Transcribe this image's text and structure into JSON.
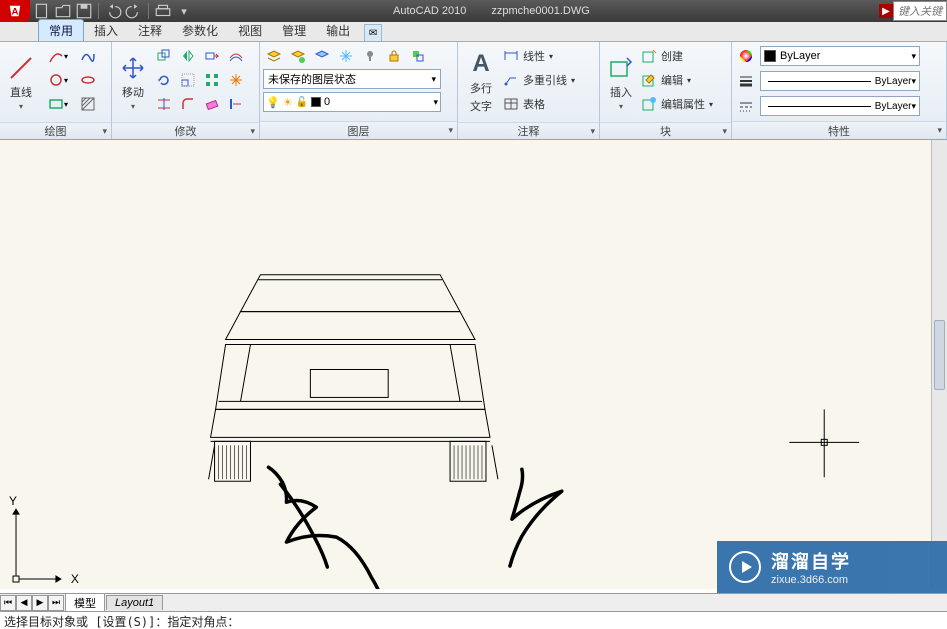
{
  "title": {
    "app": "AutoCAD 2010",
    "file": "zzpmche0001.DWG",
    "search_hint": "键入关键"
  },
  "tabs": [
    "常用",
    "插入",
    "注释",
    "参数化",
    "视图",
    "管理",
    "输出"
  ],
  "active_tab": 0,
  "panels": {
    "draw": "绘图",
    "modify": "修改",
    "layers": "图层",
    "annotation": "注释",
    "block": "块",
    "properties": "特性"
  },
  "buttons": {
    "line": "直线",
    "move": "移动",
    "mtext1": "多行",
    "mtext2": "文字",
    "insert": "插入"
  },
  "layer": {
    "state_label": "未保存的图层状态",
    "current_layer": "0"
  },
  "annotation": {
    "linear": "线性",
    "multileader": "多重引线",
    "table": "表格"
  },
  "block": {
    "create": "创建",
    "edit": "编辑",
    "edit_attrib": "编辑属性"
  },
  "properties": {
    "color": "ByLayer",
    "lineweight": "ByLayer",
    "linetype": "ByLayer"
  },
  "model_tabs": {
    "model": "模型",
    "layout1": "Layout1"
  },
  "command": "选择目标对象或 [设置(S)]：指定对角点：",
  "ucs": {
    "x": "X",
    "y": "Y"
  },
  "watermark": {
    "zh": "溜溜自学",
    "url": "zixue.3d66.com"
  }
}
